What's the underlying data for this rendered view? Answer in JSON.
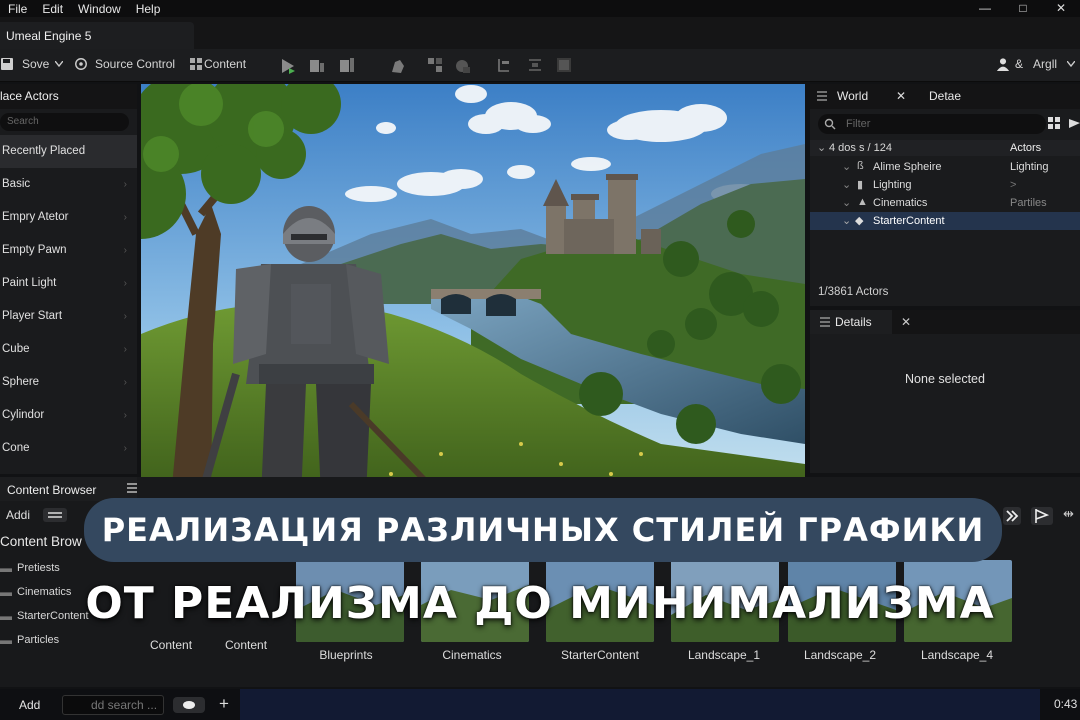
{
  "menu": [
    "File",
    "Edit",
    "Window",
    "Help"
  ],
  "window_controls": [
    "—",
    "□",
    "✕"
  ],
  "doc_tab": "Umeal Engine 5",
  "toolbar": {
    "save": "Sove",
    "source_control": "Source Control",
    "content": "Content",
    "user": "Argll"
  },
  "place_actors": {
    "title": "lace Actors",
    "search_placeholder": "Search",
    "items": [
      "Recently Placed",
      "Basic",
      "Empry Atetor",
      "Empty Pawn",
      "Paint Light",
      "Player Start",
      "Cube",
      "Sphere",
      "Cylindor",
      "Cone"
    ]
  },
  "outliner": {
    "tabs": [
      "World",
      "Detae"
    ],
    "filter_placeholder": "Filter",
    "header_left": "4 dos s / 124",
    "header_right": "Actors",
    "rows": [
      {
        "label": "Alime Spheire",
        "type": "Lighting"
      },
      {
        "label": "Lighting",
        "type": ">"
      },
      {
        "label": "Cinematics",
        "type": "Partiles"
      },
      {
        "label": "StarterContent",
        "type": ""
      }
    ],
    "count": "1/3861 Actors"
  },
  "details": {
    "title": "Details",
    "empty_text": "None selected"
  },
  "content_browser": {
    "title": "Content Browser",
    "add_label": "Addi",
    "sub_title": "Content Brow",
    "folders": [
      "Pretiests",
      "Cinematics",
      "StarterContent",
      "Particles"
    ],
    "small_items": [
      "Content",
      "Content"
    ],
    "thumbs": [
      "Blueprints",
      "Cinematics",
      "StarterContent",
      "Landscape_1",
      "Landscape_2",
      "Landscape_4"
    ]
  },
  "bottom_bar": {
    "add": "Add",
    "search_placeholder": "dd search ...",
    "time": "0:43"
  },
  "overlay": {
    "line1": "РЕАЛИЗАЦИЯ РАЗЛИЧНЫХ СТИЛЕЙ ГРАФИКИ",
    "line2": "ОТ РЕАЛИЗМА ДО МИНИМАЛИЗМА"
  },
  "colors": {
    "accent_selection": "#24344d",
    "banner": "#34485f",
    "play_green": "#4caf50"
  }
}
